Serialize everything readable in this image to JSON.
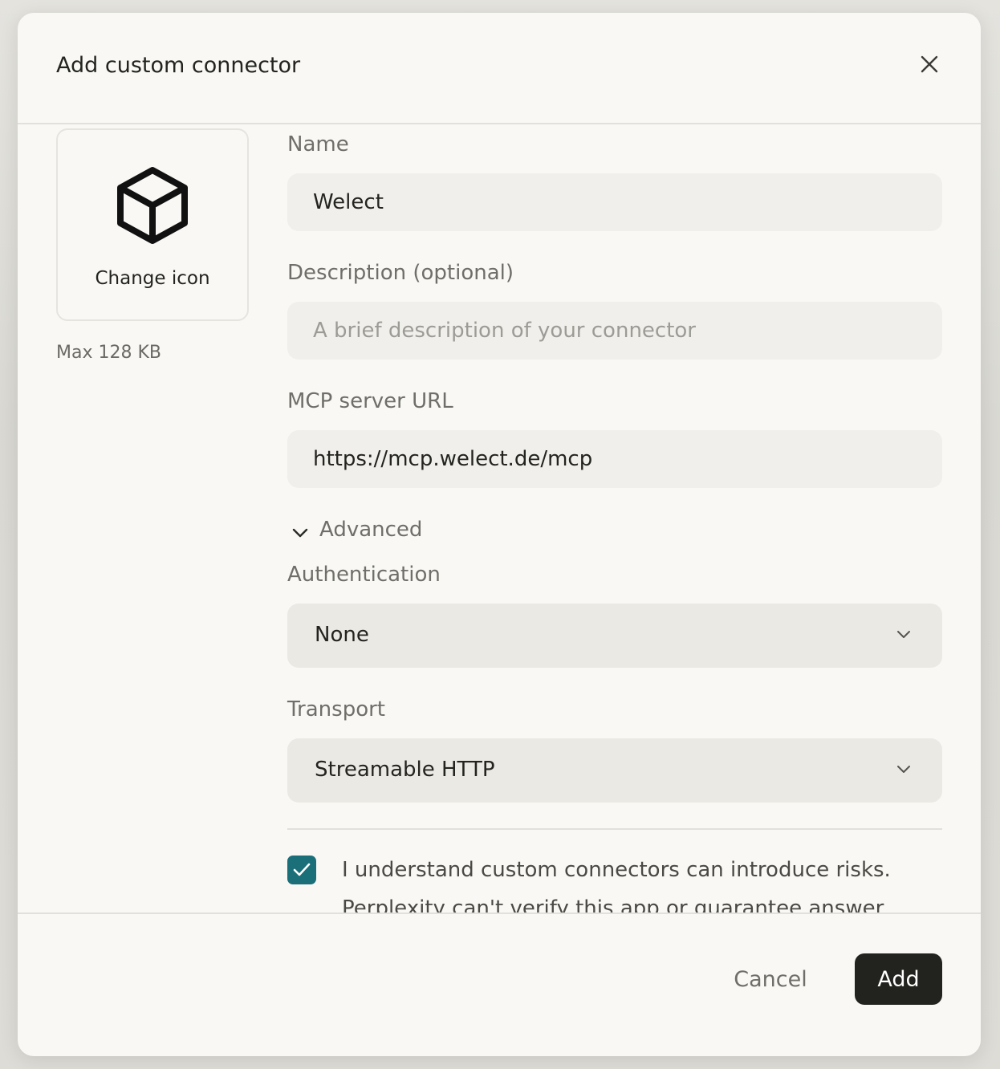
{
  "dialog": {
    "title": "Add custom connector"
  },
  "icon_picker": {
    "icon": "cube-icon",
    "label": "Change icon",
    "max_size": "Max 128 KB"
  },
  "fields": {
    "name": {
      "label": "Name",
      "value": "Welect"
    },
    "description": {
      "label": "Description (optional)",
      "value": "",
      "placeholder": "A brief description of your connector"
    },
    "url": {
      "label": "MCP server URL",
      "value": "https://mcp.welect.de/mcp"
    }
  },
  "advanced": {
    "label": "Advanced",
    "expanded": true,
    "authentication": {
      "label": "Authentication",
      "value": "None"
    },
    "transport": {
      "label": "Transport",
      "value": "Streamable HTTP"
    }
  },
  "risk": {
    "checked": true,
    "text": "I understand custom connectors can introduce risks.",
    "subtext": "Perplexity can't verify this app or guarantee answer"
  },
  "footer": {
    "cancel_label": "Cancel",
    "add_label": "Add"
  },
  "colors": {
    "checkbox": "#1a6f79",
    "primary_button": "#22221e",
    "dialog_bg": "#f9f8f5"
  }
}
